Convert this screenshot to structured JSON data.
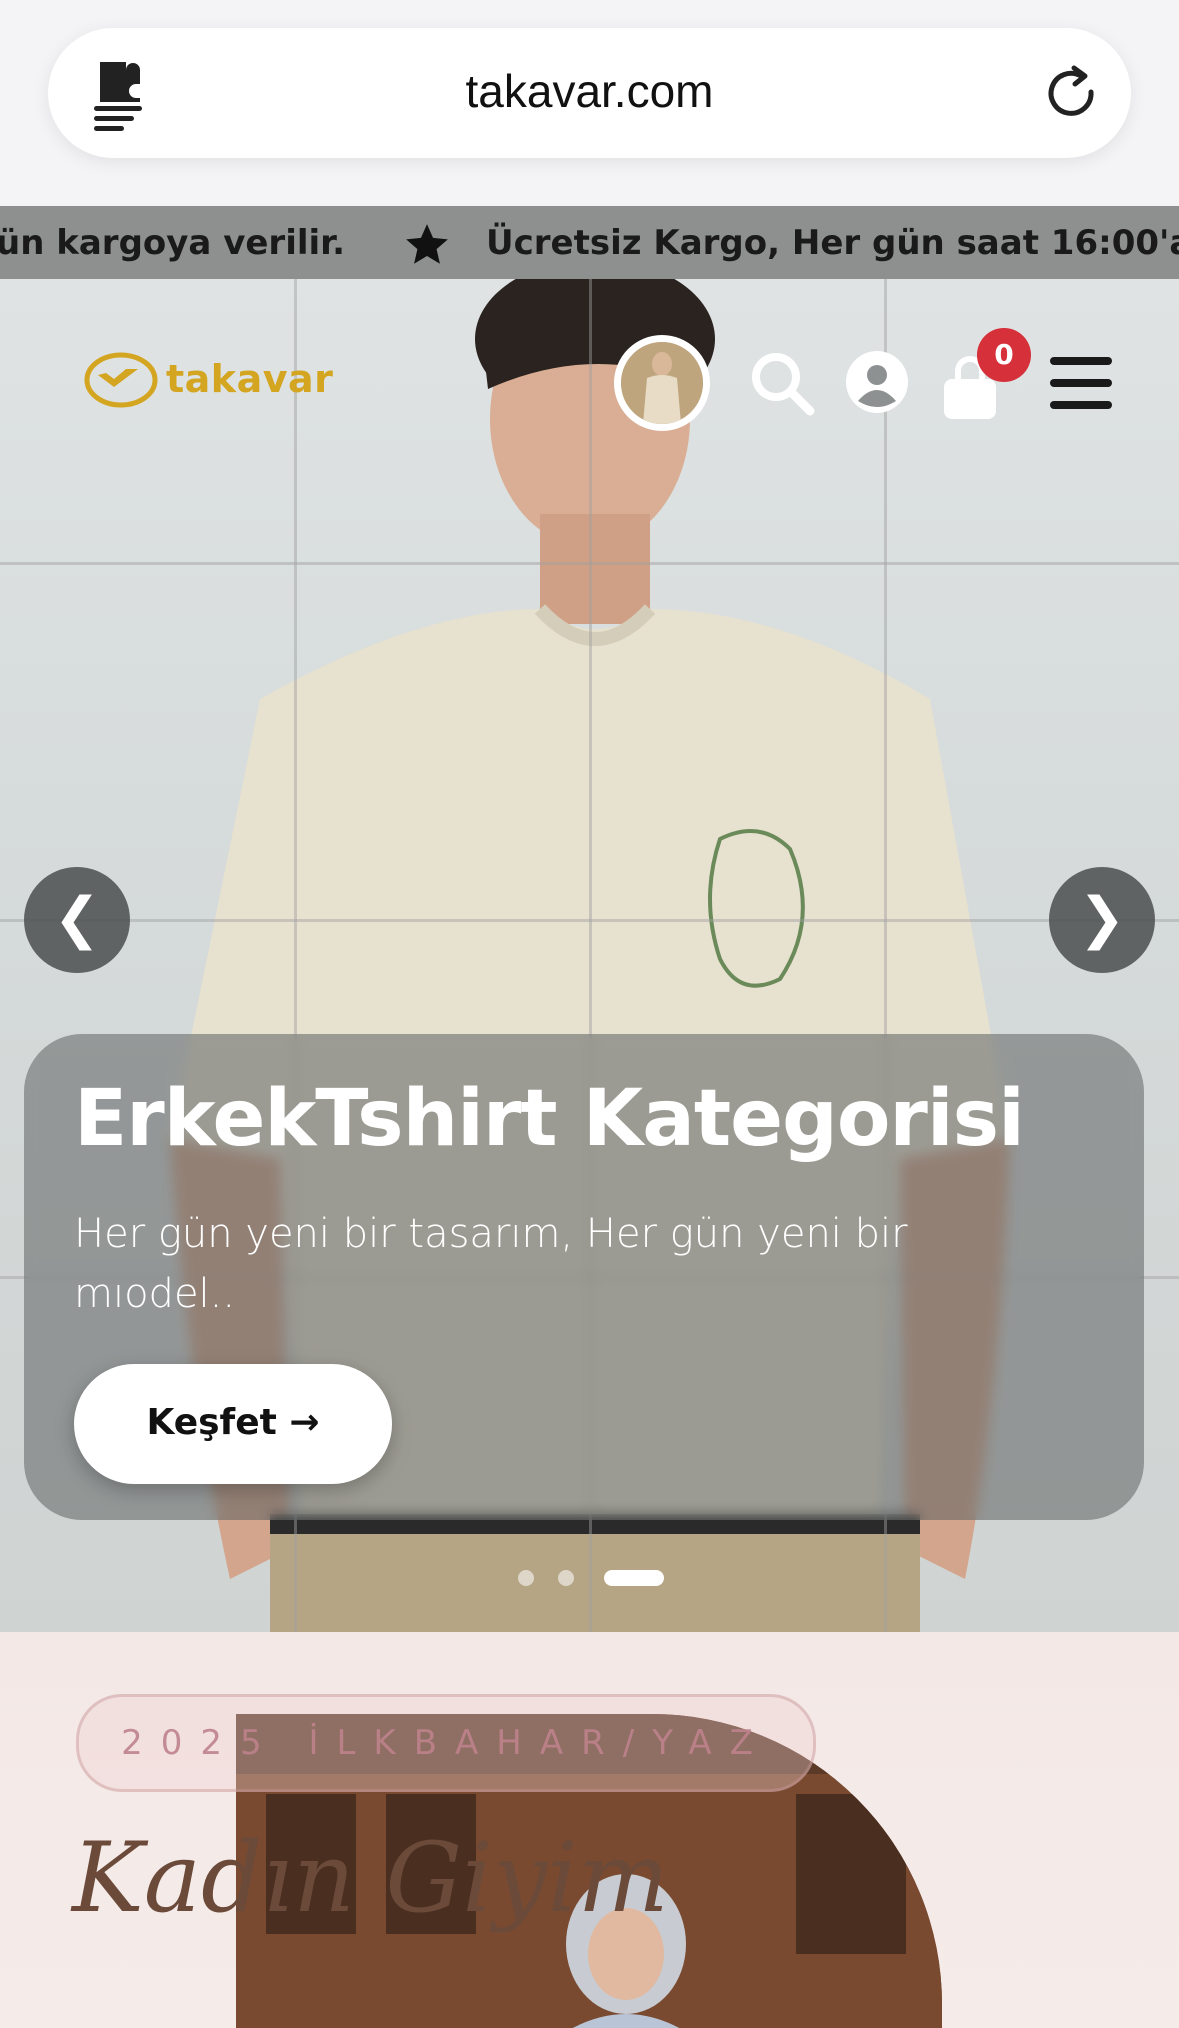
{
  "browser": {
    "url": "takavar.com"
  },
  "ticker": {
    "segments": [
      "ün kargoya verilir.",
      "Ücretsiz Kargo, Her gün saat 16:00'a k"
    ]
  },
  "header": {
    "logo_text": "takavar",
    "brand_color": "#d4a520",
    "cart_count": "0"
  },
  "hero": {
    "title": "ErkekTshirt Kategorisi",
    "subtitle": "Her gün yeni bir tasarım, Her gün yeni bir mıodel..",
    "cta_label": "Keşfet →",
    "prev_label": "❮",
    "next_label": "❯",
    "slides_total": 3,
    "active_slide": 3
  },
  "section2": {
    "season_label": "2025 İLKBAHAR/YAZ",
    "title": "Kadın Giyim"
  }
}
